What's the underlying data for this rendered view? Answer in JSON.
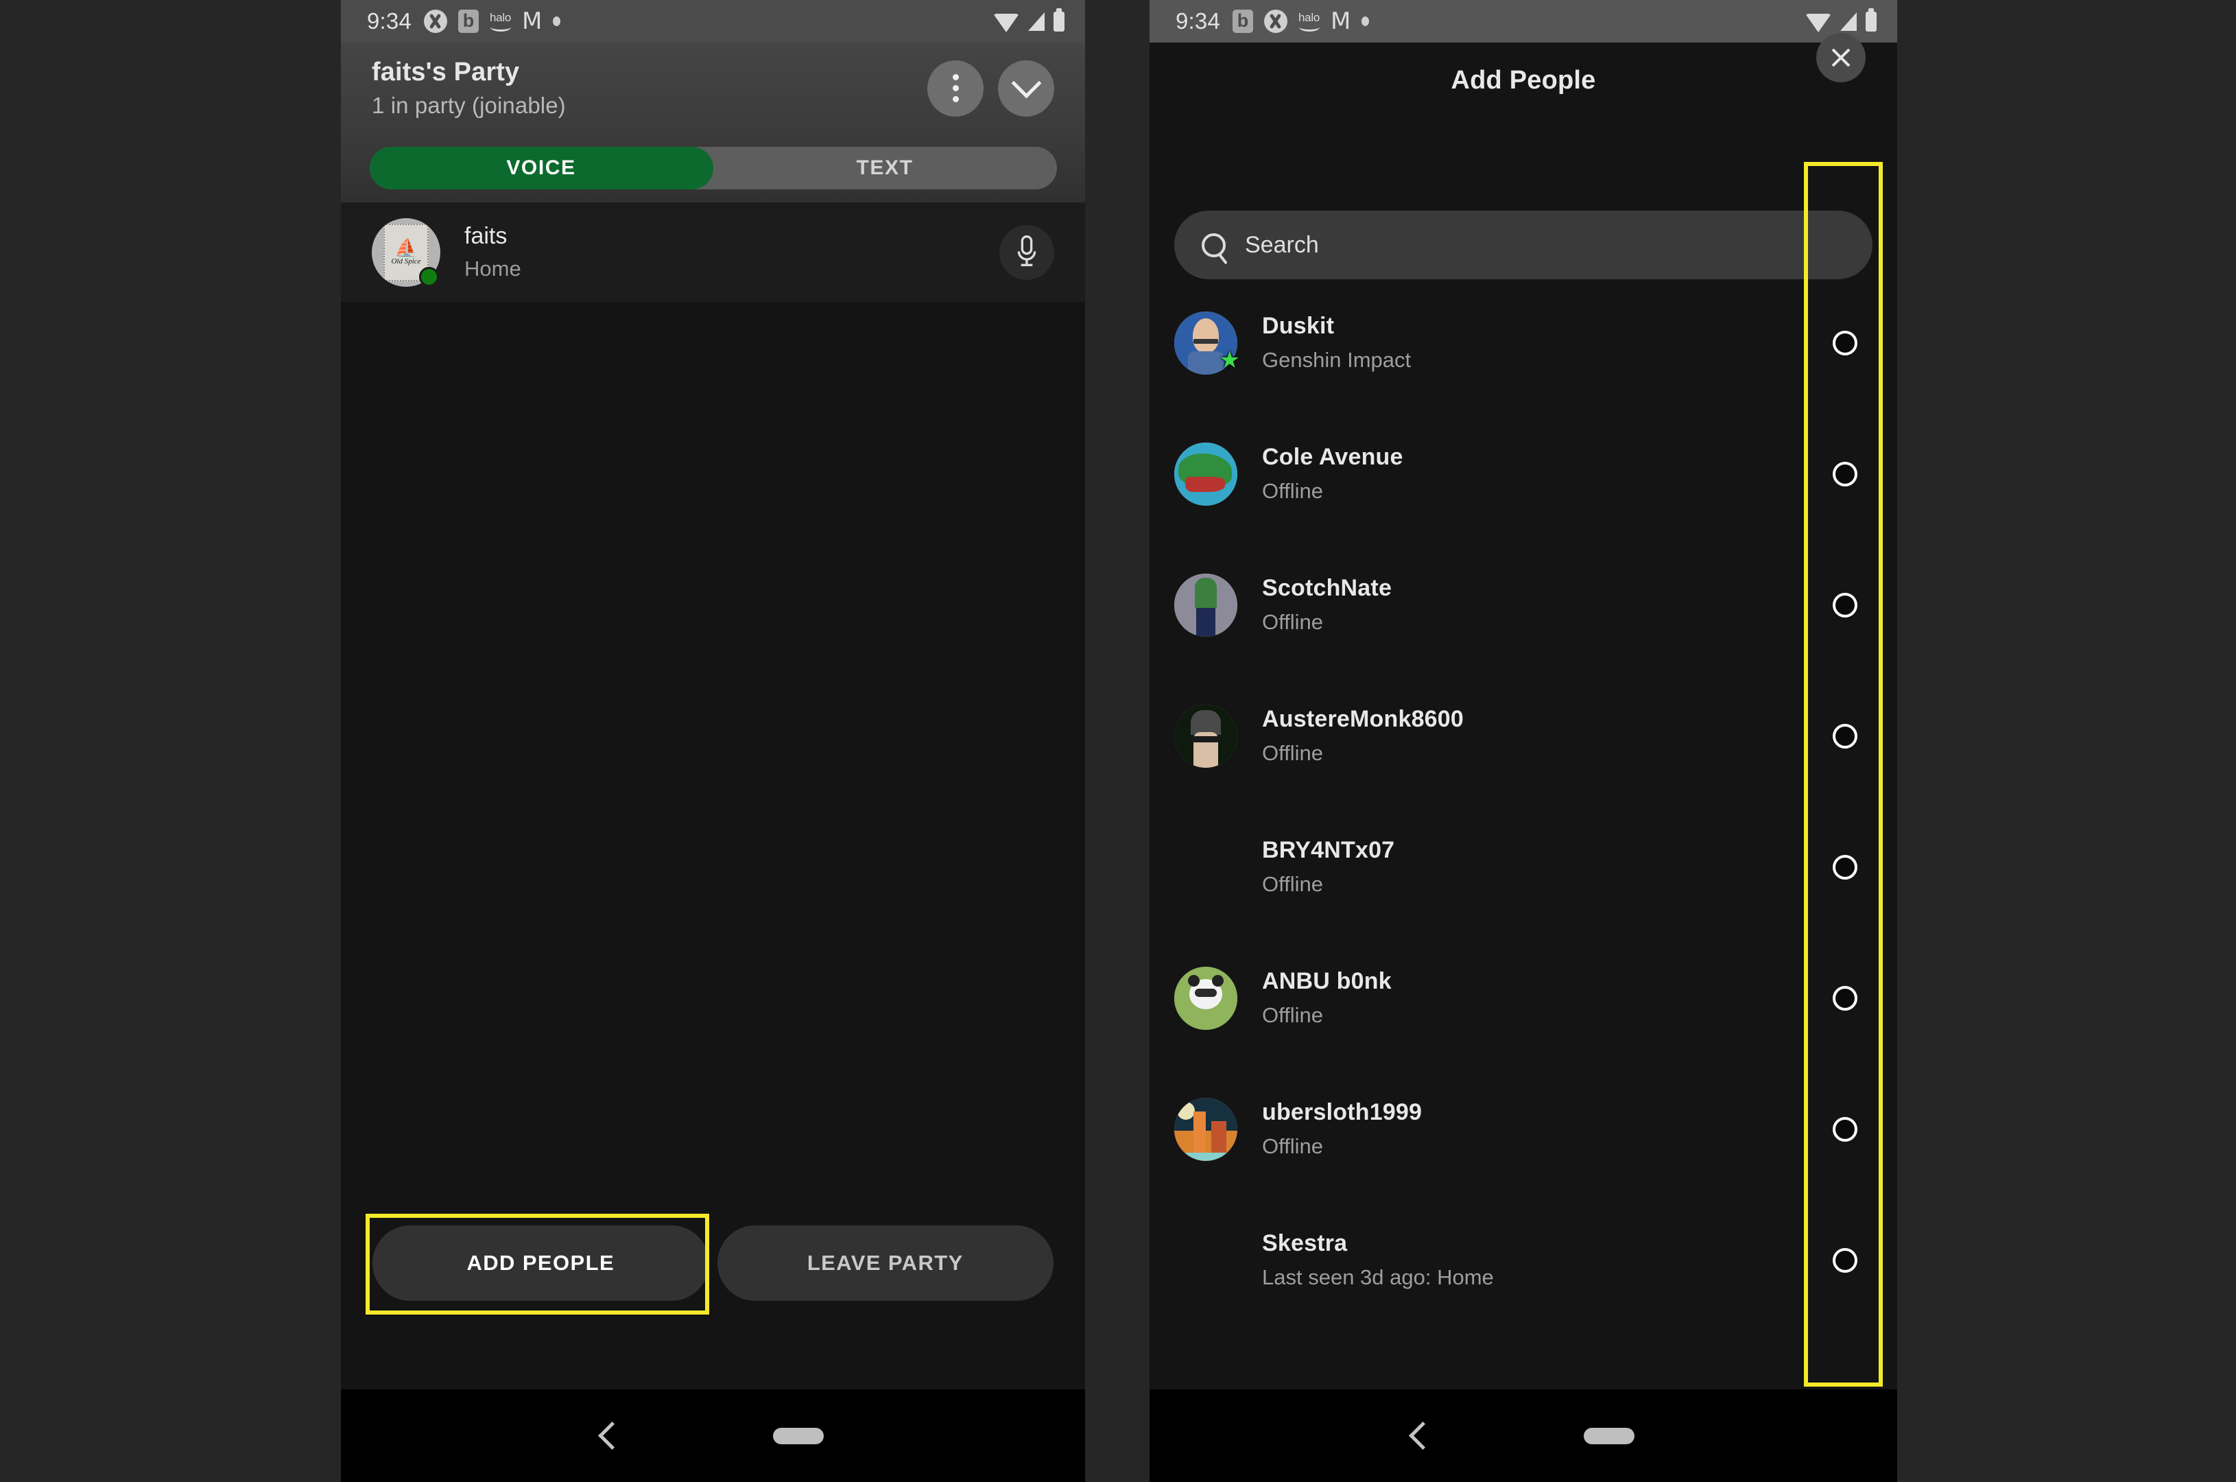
{
  "status_bar": {
    "time": "9:34",
    "left_icons": [
      "xbox-icon",
      "b-badge-icon",
      "halo-icon",
      "gmail-icon",
      "dot-icon"
    ],
    "right_icons": [
      "wifi-icon",
      "signal-icon",
      "battery-icon"
    ]
  },
  "party": {
    "title": "faits's Party",
    "subtitle": "1 in party (joinable)",
    "more_button": "more-options",
    "collapse_button": "collapse",
    "tabs": [
      {
        "label": "VOICE",
        "active": true
      },
      {
        "label": "TEXT",
        "active": false
      }
    ],
    "member": {
      "name": "faits",
      "status": "Home",
      "avatar": "old-spice-logo",
      "avatar_text_top": "Old Spice",
      "online": true,
      "mic_icon": "microphone-icon"
    },
    "actions": {
      "add_people": "ADD PEOPLE",
      "leave_party": "LEAVE PARTY"
    }
  },
  "add_people": {
    "title": "Add People",
    "close_icon": "close-icon",
    "search": {
      "placeholder": "Search",
      "value": "",
      "icon": "search-icon"
    },
    "people": [
      {
        "name": "Duskit",
        "status": "Genshin Impact",
        "avatar": "duskit",
        "online": true,
        "has_avatar": true
      },
      {
        "name": "Cole Avenue",
        "status": "Offline",
        "avatar": "dino",
        "online": false,
        "has_avatar": true
      },
      {
        "name": "ScotchNate",
        "status": "Offline",
        "avatar": "scotch",
        "online": false,
        "has_avatar": true
      },
      {
        "name": "AustereMonk8600",
        "status": "Offline",
        "avatar": "monk",
        "online": false,
        "has_avatar": true
      },
      {
        "name": "BRY4NTx07",
        "status": "Offline",
        "avatar": "",
        "online": false,
        "has_avatar": false
      },
      {
        "name": "ANBU b0nk",
        "status": "Offline",
        "avatar": "panda",
        "online": false,
        "has_avatar": true
      },
      {
        "name": "ubersloth1999",
        "status": "Offline",
        "avatar": "city",
        "online": false,
        "has_avatar": true
      },
      {
        "name": "Skestra",
        "status": "Last seen 3d ago: Home",
        "avatar": "",
        "online": false,
        "has_avatar": false
      }
    ]
  },
  "nav_bar": {
    "back_icon": "back-chevron-icon",
    "home_icon": "home-pill-icon"
  },
  "annotations": {
    "highlight_color": "#f5ea2a",
    "left_target": "ADD PEOPLE",
    "right_target": "selection radio buttons column"
  }
}
